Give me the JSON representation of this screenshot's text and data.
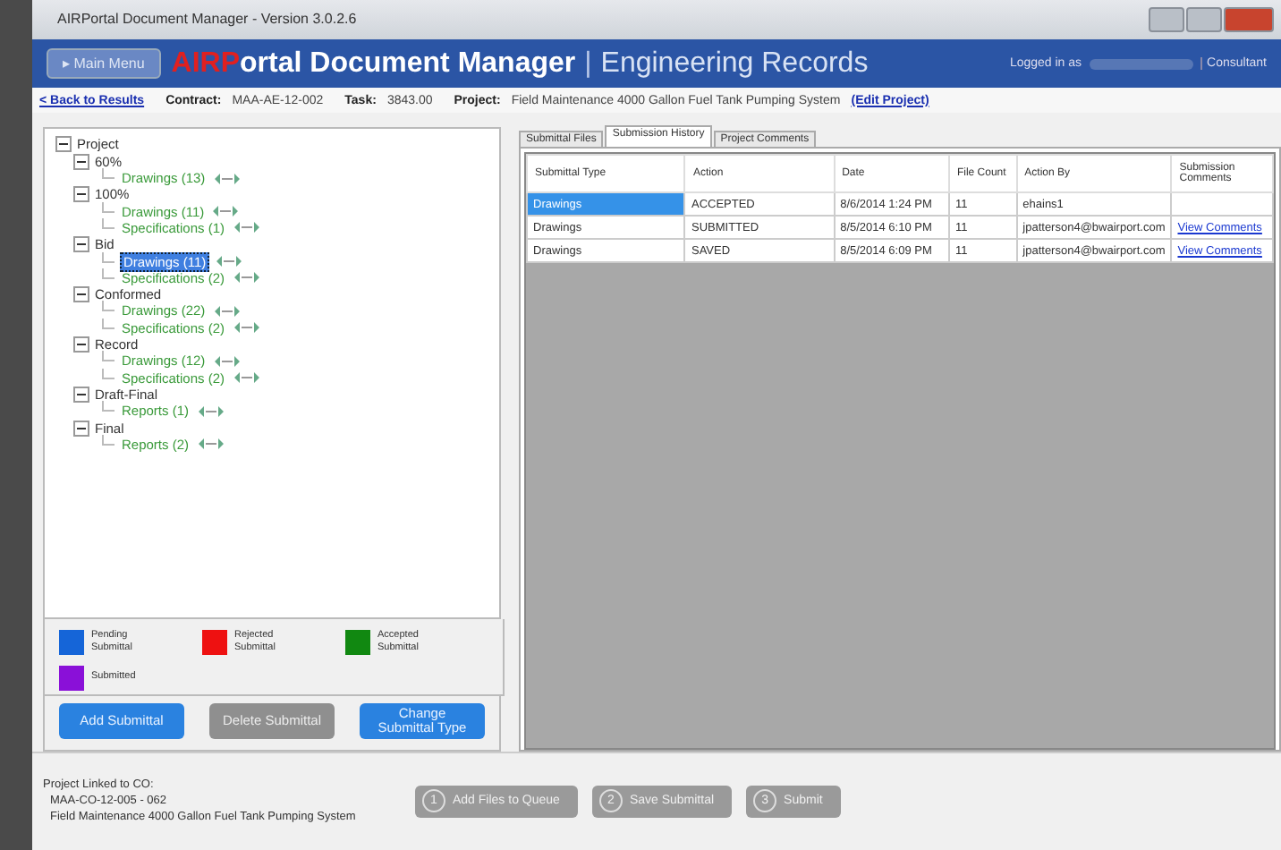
{
  "window": {
    "title": "AIRPortal Document Manager - Version 3.0.2.6"
  },
  "header": {
    "main_menu": "▸ Main Menu",
    "brand_mark": "AIRP",
    "brand_rest": "ortal Document Manager",
    "separator": "|",
    "section": "Engineering Records",
    "logged_in": "Logged in as",
    "role": "Consultant"
  },
  "nav": {
    "back": "< Back to Results",
    "contract_label": "Contract:",
    "contract": "MAA-AE-12-002",
    "task_label": "Task:",
    "task": "3843.00",
    "project_label": "Project:",
    "project": "Field Maintenance 4000 Gallon Fuel Tank Pumping System",
    "edit": "(Edit Project)"
  },
  "tree": [
    {
      "label": "Project",
      "expanded": true,
      "children": [
        {
          "label": "60%",
          "expanded": true,
          "children": [
            {
              "label": "Drawings (13)",
              "selected": false
            }
          ]
        },
        {
          "label": "100%",
          "expanded": true,
          "children": [
            {
              "label": "Drawings (11)",
              "selected": false
            },
            {
              "label": "Specifications (1)",
              "selected": false
            }
          ]
        },
        {
          "label": "Bid",
          "expanded": true,
          "children": [
            {
              "label": "Drawings (11)",
              "selected": true
            },
            {
              "label": "Specifications (2)",
              "selected": false
            }
          ]
        },
        {
          "label": "Conformed",
          "expanded": true,
          "children": [
            {
              "label": "Drawings (22)",
              "selected": false
            },
            {
              "label": "Specifications (2)",
              "selected": false
            }
          ]
        },
        {
          "label": "Record",
          "expanded": true,
          "children": [
            {
              "label": "Drawings (12)",
              "selected": false
            },
            {
              "label": "Specifications (2)",
              "selected": false
            }
          ]
        },
        {
          "label": "Draft-Final",
          "expanded": true,
          "children": [
            {
              "label": "Reports (1)",
              "selected": false
            }
          ]
        },
        {
          "label": "Final",
          "expanded": true,
          "children": [
            {
              "label": "Reports (2)",
              "selected": false
            }
          ]
        }
      ]
    }
  ],
  "legend": [
    {
      "label": "Pending Submittal",
      "color": "#1565d8"
    },
    {
      "label": "Rejected Submittal",
      "color": "#ee1111"
    },
    {
      "label": "Accepted Submittal",
      "color": "#118811"
    },
    {
      "label": "Submitted",
      "color": "#8a10d8"
    }
  ],
  "left_buttons": [
    {
      "label": "Add Submittal",
      "disabled": false
    },
    {
      "label": "Delete Submittal",
      "disabled": true
    },
    {
      "label": "Change Submittal Type",
      "disabled": false
    }
  ],
  "linked": {
    "title": "Project Linked to CO:",
    "code": "MAA-CO-12-005 - 062",
    "name": "Field Maintenance 4000 Gallon Fuel Tank Pumping System"
  },
  "tabs": [
    {
      "label": "Submittal Files",
      "selected": false
    },
    {
      "label": "Submission History",
      "selected": true
    },
    {
      "label": "Project Comments",
      "selected": false
    }
  ],
  "table": {
    "columns": [
      "Submittal Type",
      "Action",
      "Date",
      "File Count",
      "Action By",
      "Submission Comments"
    ],
    "rows": [
      {
        "selected": true,
        "cells": [
          "Drawings",
          "ACCEPTED",
          "8/6/2014 1:24 PM",
          "11",
          "ehains1",
          ""
        ]
      },
      {
        "selected": false,
        "cells": [
          "Drawings",
          "SUBMITTED",
          "8/5/2014 6:10 PM",
          "11",
          "jpatterson4@bwairport.com",
          "View Comments"
        ]
      },
      {
        "selected": false,
        "cells": [
          "Drawings",
          "SAVED",
          "8/5/2014 6:09 PM",
          "11",
          "jpatterson4@bwairport.com",
          "View Comments"
        ]
      }
    ]
  },
  "steps": [
    {
      "number": "1",
      "label": "Add Files to Queue",
      "disabled": true
    },
    {
      "number": "2",
      "label": "Save Submittal",
      "disabled": true
    },
    {
      "number": "3",
      "label": "Submit",
      "disabled": true
    }
  ]
}
